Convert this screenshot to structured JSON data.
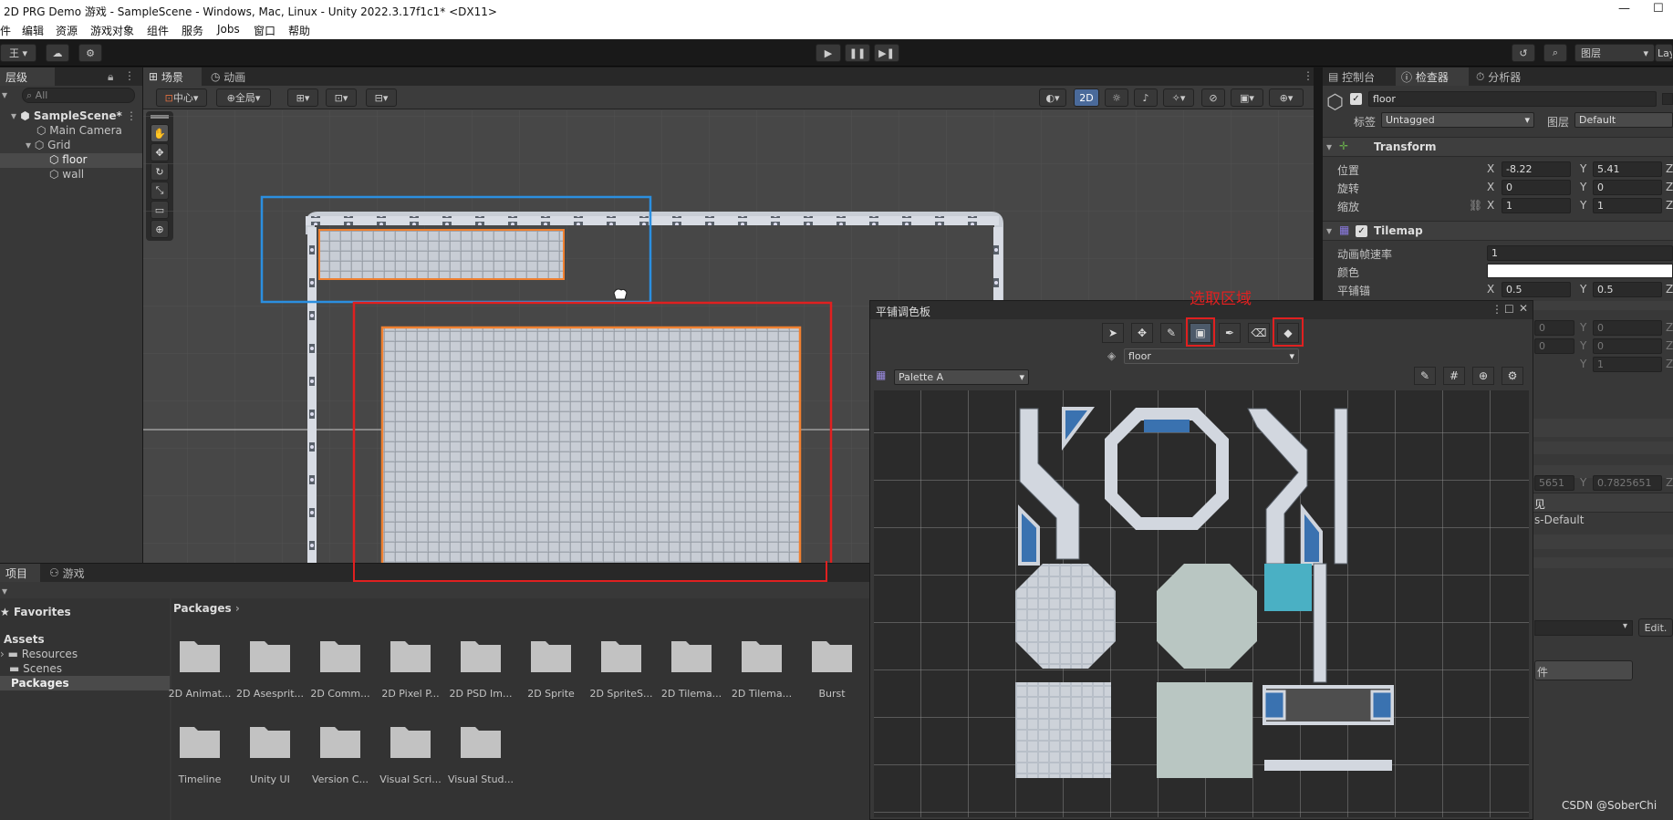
{
  "window": {
    "title": "2D PRG Demo 游戏 - SampleScene - Windows, Mac, Linux - Unity 2022.3.17f1c1* <DX11>",
    "minimize": "—",
    "maximize": "☐"
  },
  "menu": [
    "件",
    "编辑",
    "资源",
    "游戏对象",
    "组件",
    "服务",
    "Jobs",
    "窗口",
    "帮助"
  ],
  "toolbar": {
    "account": "王",
    "layers_label": "图层",
    "layout_label": "Lay"
  },
  "hierarchy": {
    "tab": "层级",
    "search_placeholder": "All",
    "scene": "SampleScene*",
    "items": [
      "Main Camera",
      "Grid",
      "floor",
      "wall"
    ]
  },
  "scene_view": {
    "tabs": [
      "场景",
      "动画"
    ],
    "pivot": "中心",
    "global": "全局",
    "mode_2d": "2D"
  },
  "inspector": {
    "tabs": [
      "控制台",
      "检查器",
      "分析器"
    ],
    "object_name": "floor",
    "tag_label": "标签",
    "tag_value": "Untagged",
    "layer_label": "图层",
    "layer_value": "Default",
    "transform": {
      "title": "Transform",
      "position_label": "位置",
      "rotation_label": "旋转",
      "scale_label": "缩放",
      "position": [
        "-8.22",
        "5.41"
      ],
      "rotation": [
        "0",
        "0"
      ],
      "scale": [
        "1",
        "1"
      ]
    },
    "tilemap": {
      "title": "Tilemap",
      "anim_rate_label": "动画帧速率",
      "anim_rate_value": "1",
      "color_label": "颜色",
      "anchor_label": "平铺锚",
      "anchor": [
        "0.5",
        "0.5"
      ]
    },
    "hidden_fields": {
      "x0": "0",
      "y0": "0",
      "x1": "0",
      "y1": "0",
      "y2": "1",
      "value_a": "5651",
      "value_b": "0.7825651",
      "text_a": "见",
      "text_b": "s-Default",
      "edit_button": "Edit.",
      "text_c": "件"
    }
  },
  "project": {
    "tabs": [
      "项目",
      "游戏"
    ],
    "favorites": "Favorites",
    "assets": "Assets",
    "resources": "Resources",
    "scenes": "Scenes",
    "packages": "Packages",
    "breadcrumb": "Packages",
    "folders": [
      "2D Animat...",
      "2D Asesprit...",
      "2D Comm...",
      "2D Pixel P...",
      "2D PSD Im...",
      "2D Sprite",
      "2D SpriteS...",
      "2D Tilema...",
      "2D Tilema...",
      "Burst",
      "Timeline",
      "Unity UI",
      "Version C...",
      "Visual Scri...",
      "Visual Stud..."
    ]
  },
  "palette": {
    "title": "平铺调色板",
    "annotation": "选取区域",
    "target": "floor",
    "palette_name": "Palette A"
  },
  "watermark": "CSDN @SoberChi",
  "colors": {
    "selection_red": "#e02020",
    "selection_blue": "#2b8fe0",
    "tile_orange": "#f08030",
    "unity_blue": "#3a72b0"
  }
}
